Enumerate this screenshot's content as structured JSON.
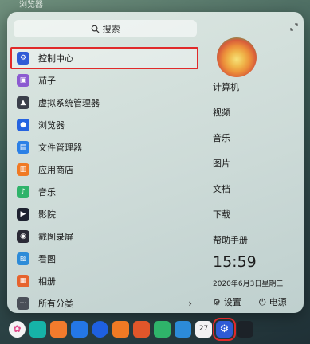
{
  "topbar": {
    "text": "浏览器"
  },
  "search": {
    "placeholder": "搜索"
  },
  "apps": [
    {
      "label": "控制中心",
      "icon": "control-center-icon",
      "color": "#2f5bd6",
      "glyph": "⚙"
    },
    {
      "label": "茄子",
      "icon": "eggplant-icon",
      "color": "#8c5bd1",
      "glyph": "▣"
    },
    {
      "label": "虚拟系统管理器",
      "icon": "virtual-machine-icon",
      "color": "#3a3f4a",
      "glyph": "▲"
    },
    {
      "label": "浏览器",
      "icon": "browser-icon",
      "color": "#2563e0",
      "glyph": "●"
    },
    {
      "label": "文件管理器",
      "icon": "file-manager-icon",
      "color": "#2b80e6",
      "glyph": "▤"
    },
    {
      "label": "应用商店",
      "icon": "app-store-icon",
      "color": "#f07a24",
      "glyph": "▥"
    },
    {
      "label": "音乐",
      "icon": "music-icon",
      "color": "#2fb36a",
      "glyph": "♪"
    },
    {
      "label": "影院",
      "icon": "movie-icon",
      "color": "#1e2230",
      "glyph": "▶"
    },
    {
      "label": "截图录屏",
      "icon": "screenshot-icon",
      "color": "#2a2a36",
      "glyph": "◉"
    },
    {
      "label": "看图",
      "icon": "image-viewer-icon",
      "color": "#2c8bd8",
      "glyph": "▨"
    },
    {
      "label": "相册",
      "icon": "album-icon",
      "color": "#e6632e",
      "glyph": "▦"
    },
    {
      "label": "所有分类",
      "icon": "all-categories-icon",
      "color": "#4a4f58",
      "glyph": "⋯",
      "arrow": "›"
    }
  ],
  "right": {
    "computer": "计算机",
    "video": "视频",
    "music": "音乐",
    "pictures": "图片",
    "documents": "文档",
    "downloads": "下载",
    "help": "帮助手册",
    "time": "15:59",
    "date": "2020年6月3日星期三",
    "settings": "设置",
    "power": "电源"
  },
  "dock": [
    {
      "name": "launcher-icon",
      "color": "#f4f4f4"
    },
    {
      "name": "multitask-view-icon",
      "color": "#16b3a8"
    },
    {
      "name": "dock-app-store-icon",
      "color": "#f27b2d"
    },
    {
      "name": "dock-file-manager-icon",
      "color": "#2477e6"
    },
    {
      "name": "dock-browser-icon",
      "color": "#1e60e0"
    },
    {
      "name": "dock-store-icon",
      "color": "#f07a24"
    },
    {
      "name": "dock-album-icon",
      "color": "#e0562a"
    },
    {
      "name": "dock-music-icon",
      "color": "#2fb36a"
    },
    {
      "name": "dock-document-viewer-icon",
      "color": "#2c8bd8"
    },
    {
      "name": "dock-calendar-icon",
      "color": "#f2f2f2",
      "text": "27"
    },
    {
      "name": "dock-control-center-icon",
      "color": "#2f5bd6"
    },
    {
      "name": "dock-terminal-icon",
      "color": "#1c2228"
    }
  ],
  "colors": {
    "highlight": "#e02a2a"
  }
}
